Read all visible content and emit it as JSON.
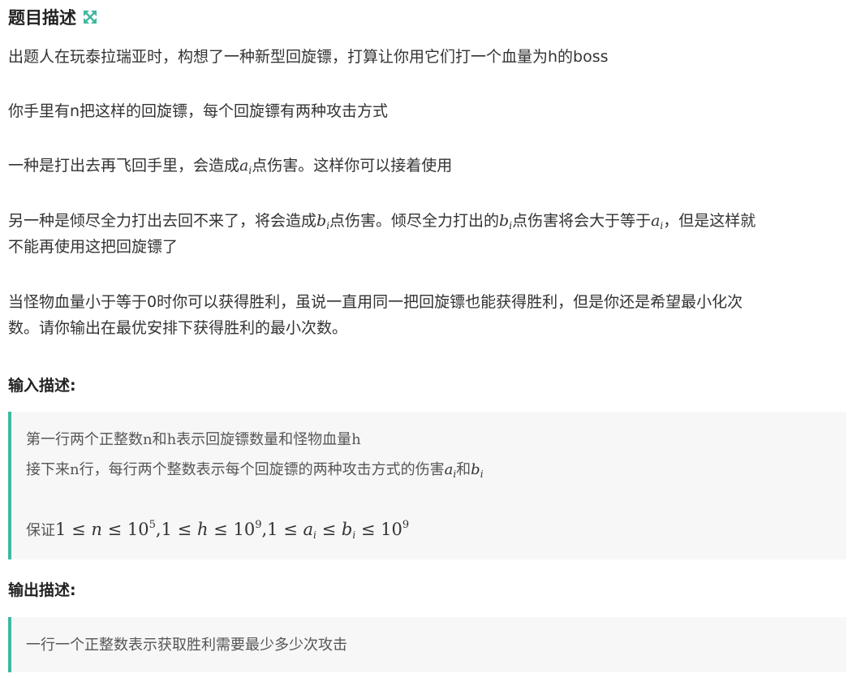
{
  "title": "题目描述",
  "icons": {
    "expand": "expand-arrows-icon",
    "accent_color": "#3eb8a0"
  },
  "description": {
    "p1": "出题人在玩泰拉瑞亚时，构想了一种新型回旋镖，打算让你用它们打一个血量为h的boss",
    "p2": "你手里有n把这样的回旋镖，每个回旋镖有两种攻击方式",
    "p3": {
      "pre": "一种是打出去再飞回手里，会造成",
      "var": "a",
      "sub": "i",
      "post": "点伤害。这样你可以接着使用"
    },
    "p4": {
      "t1": "另一种是倾尽全力打出去回不来了，将会造成",
      "var1": "b",
      "sub1": "i",
      "t2": "点伤害。倾尽全力打出的",
      "var2": "b",
      "sub2": "i",
      "t3": "点伤害将会大于等于",
      "var3": "a",
      "sub3": "i",
      "t4": "，但是这样就",
      "line2": "不能再使用这把回旋镖了"
    },
    "p5": {
      "line1": "当怪物血量小于等于0时你可以获得胜利，虽说一直用同一把回旋镖也能获得胜利，但是你还是希望最小化次",
      "line2": "数。请你输出在最优安排下获得胜利的最小次数。"
    }
  },
  "input": {
    "title": "输入描述:",
    "line1": "第一行两个正整数n和h表示回旋镖数量和怪物血量h",
    "line2": {
      "pre": "接下来n行，每行两个整数表示每个回旋镖的两种攻击方式的伤害",
      "var1": "a",
      "sub1": "i",
      "mid": "和",
      "var2": "b",
      "sub2": "i"
    },
    "constraint": {
      "label": "保证",
      "one": "1",
      "le": "≤",
      "n": "n",
      "ten": "10",
      "exp5": "5",
      "comma": ",",
      "h": "h",
      "exp9": "9",
      "a": "a",
      "b": "b",
      "i": "i"
    }
  },
  "output": {
    "title": "输出描述:",
    "line1": "一行一个正整数表示获取胜利需要最少多少次攻击"
  }
}
